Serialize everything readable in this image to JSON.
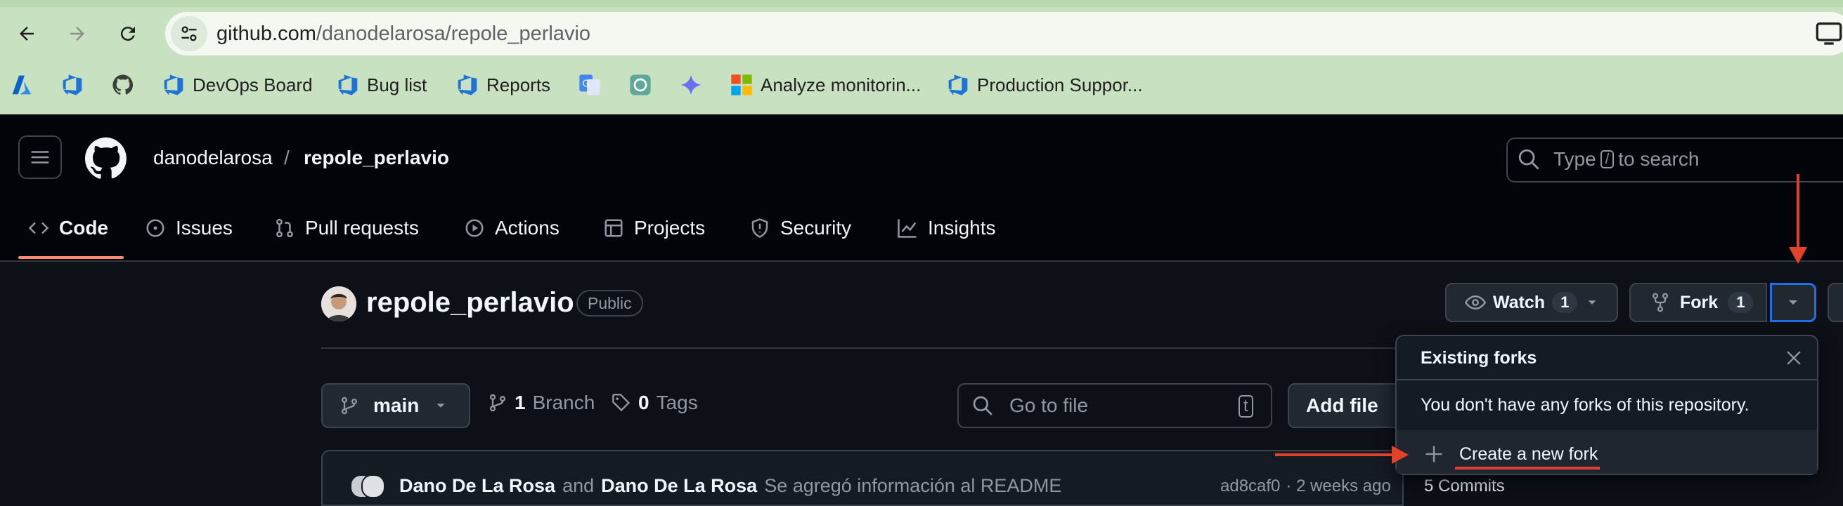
{
  "browser": {
    "url_host": "github.com",
    "url_path": "/danodelarosa/repole_perlavio",
    "bookmarks": [
      {
        "label": "",
        "icon": "azure-icon"
      },
      {
        "label": "",
        "icon": "azure-devops-icon"
      },
      {
        "label": "",
        "icon": "github-icon"
      },
      {
        "label": "DevOps Board",
        "icon": "azure-devops-icon"
      },
      {
        "label": "Bug list",
        "icon": "azure-devops-icon"
      },
      {
        "label": "Reports",
        "icon": "azure-devops-icon"
      },
      {
        "label": "",
        "icon": "google-translate-icon"
      },
      {
        "label": "",
        "icon": "chatgpt-icon"
      },
      {
        "label": "",
        "icon": "gemini-icon"
      },
      {
        "label": "Analyze monitorin...",
        "icon": "microsoft-icon"
      },
      {
        "label": "Production Suppor...",
        "icon": "azure-devops-icon"
      }
    ]
  },
  "header": {
    "owner": "danodelarosa",
    "separator": "/",
    "repo": "repole_perlavio",
    "search_prefix": "Type",
    "search_key": "/",
    "search_suffix": "to search"
  },
  "tabs": [
    {
      "label": "Code",
      "icon": "code-icon",
      "active": true
    },
    {
      "label": "Issues",
      "icon": "issue-icon"
    },
    {
      "label": "Pull requests",
      "icon": "pull-request-icon"
    },
    {
      "label": "Actions",
      "icon": "play-icon"
    },
    {
      "label": "Projects",
      "icon": "table-icon"
    },
    {
      "label": "Security",
      "icon": "shield-icon"
    },
    {
      "label": "Insights",
      "icon": "graph-icon"
    }
  ],
  "repo": {
    "name": "repole_perlavio",
    "visibility": "Public",
    "watch_label": "Watch",
    "watch_count": "1",
    "fork_label": "Fork",
    "fork_count": "1"
  },
  "file_nav": {
    "branch": "main",
    "branch_count": "1",
    "branch_label": "Branch",
    "tag_count": "0",
    "tag_label": "Tags",
    "go_to_file_placeholder": "Go to file",
    "go_to_file_key": "t",
    "add_file_label": "Add file"
  },
  "latest_commit": {
    "author1": "Dano De La Rosa",
    "and": "and",
    "author2": "Dano De La Rosa",
    "message": "Se agregó información al README",
    "hash": "ad8caf0",
    "time": "· 2 weeks ago",
    "commits": "5 Commits"
  },
  "fork_menu": {
    "title": "Existing forks",
    "message": "You don't have any forks of this repository.",
    "create_label": "Create a new fork"
  },
  "colors": {
    "annotation_red": "#e2422c",
    "active_tab_underline": "#fd8c73",
    "focus_blue": "#1f6feb"
  }
}
